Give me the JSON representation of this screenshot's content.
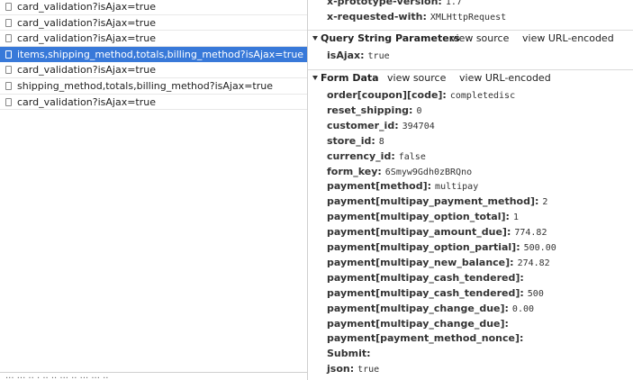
{
  "requests": [
    {
      "name": "card_validation?isAjax=true",
      "selected": false
    },
    {
      "name": "card_validation?isAjax=true",
      "selected": false
    },
    {
      "name": "card_validation?isAjax=true",
      "selected": false
    },
    {
      "name": "items,shipping_method,totals,billing_method?isAjax=true",
      "selected": true
    },
    {
      "name": "card_validation?isAjax=true",
      "selected": false
    },
    {
      "name": "shipping_method,totals,billing_method?isAjax=true",
      "selected": false
    },
    {
      "name": "card_validation?isAjax=true",
      "selected": false
    }
  ],
  "left_status": "··· ··· ·· · ·· ·· ··· ·· ··· ··· ··",
  "request_headers": [
    {
      "key": "x-prototype-version:",
      "value": "1.7"
    },
    {
      "key": "x-requested-with:",
      "value": "XMLHttpRequest"
    }
  ],
  "query_section": {
    "title": "Query String Parameters",
    "view_source": "view source",
    "view_url_encoded": "view URL-encoded",
    "params": [
      {
        "key": "isAjax:",
        "value": "true"
      }
    ]
  },
  "form_section": {
    "title": "Form Data",
    "view_source": "view source",
    "view_url_encoded": "view URL-encoded",
    "params": [
      {
        "key": "order[coupon][code]:",
        "value": "completedisc"
      },
      {
        "key": "reset_shipping:",
        "value": "0"
      },
      {
        "key": "customer_id:",
        "value": "394704"
      },
      {
        "key": "store_id:",
        "value": "8"
      },
      {
        "key": "currency_id:",
        "value": "false"
      },
      {
        "key": "form_key:",
        "value": "6Smyw9Gdh0zBRQno"
      },
      {
        "key": "payment[method]:",
        "value": "multipay"
      },
      {
        "key": "payment[multipay_payment_method]:",
        "value": "2"
      },
      {
        "key": "payment[multipay_option_total]:",
        "value": "1"
      },
      {
        "key": "payment[multipay_amount_due]:",
        "value": "774.82"
      },
      {
        "key": "payment[multipay_option_partial]:",
        "value": "500.00"
      },
      {
        "key": "payment[multipay_new_balance]:",
        "value": "274.82"
      },
      {
        "key": "payment[multipay_cash_tendered]:",
        "value": ""
      },
      {
        "key": "payment[multipay_cash_tendered]:",
        "value": "500"
      },
      {
        "key": "payment[multipay_change_due]:",
        "value": "0.00"
      },
      {
        "key": "payment[multipay_change_due]:",
        "value": ""
      },
      {
        "key": "payment[payment_method_nonce]:",
        "value": ""
      },
      {
        "key": "Submit:",
        "value": ""
      },
      {
        "key": "json:",
        "value": "true"
      }
    ]
  }
}
